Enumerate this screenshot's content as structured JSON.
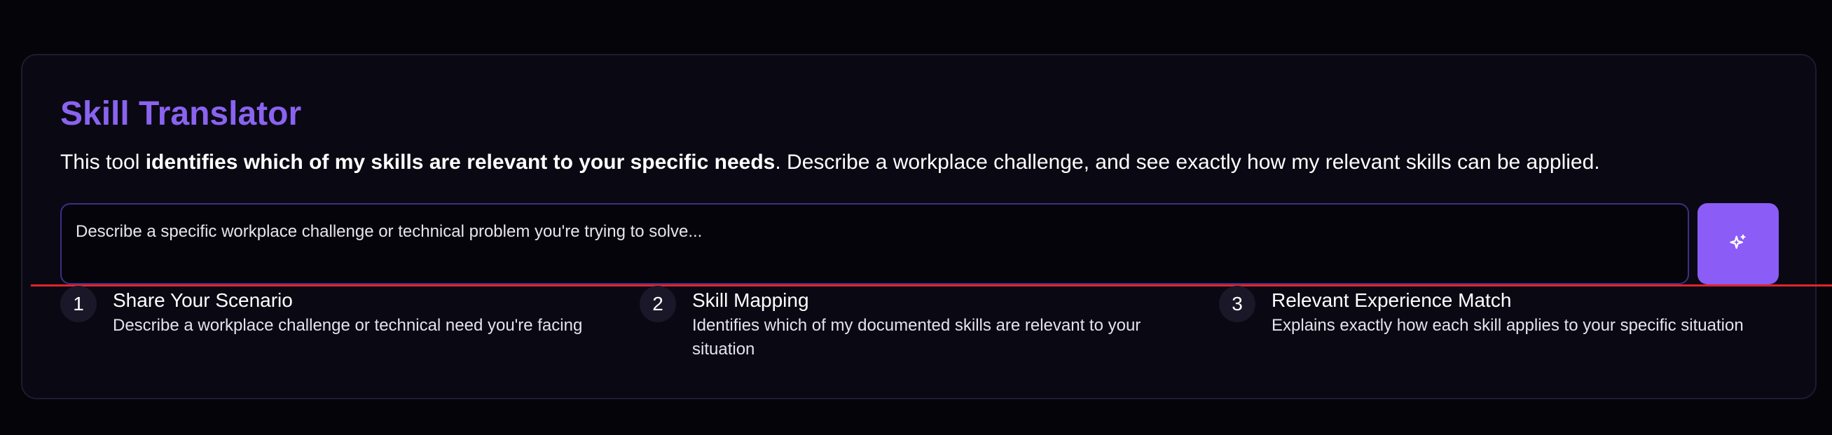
{
  "tool": {
    "title": "Skill Translator",
    "description_prefix": "This tool ",
    "description_bold": "identifies which of my skills are relevant to your specific needs",
    "description_suffix": ". Describe a workplace challenge, and see exactly how my relevant skills can be applied."
  },
  "input": {
    "placeholder": "Describe a specific workplace challenge or technical problem you're trying to solve...",
    "value": ""
  },
  "submit_button": {
    "icon": "sparkles-icon"
  },
  "steps": [
    {
      "number": "1",
      "title": "Share Your Scenario",
      "description": "Describe a workplace challenge or technical need you're facing"
    },
    {
      "number": "2",
      "title": "Skill Mapping",
      "description": "Identifies which of my documented skills are relevant to your situation"
    },
    {
      "number": "3",
      "title": "Relevant Experience Match",
      "description": "Explains exactly how each skill applies to your specific situation"
    }
  ],
  "colors": {
    "background": "#050409",
    "card": "#0a0812",
    "accent": "#8b5cf6",
    "title": "#8a63f0",
    "divider": "#e0242e"
  }
}
